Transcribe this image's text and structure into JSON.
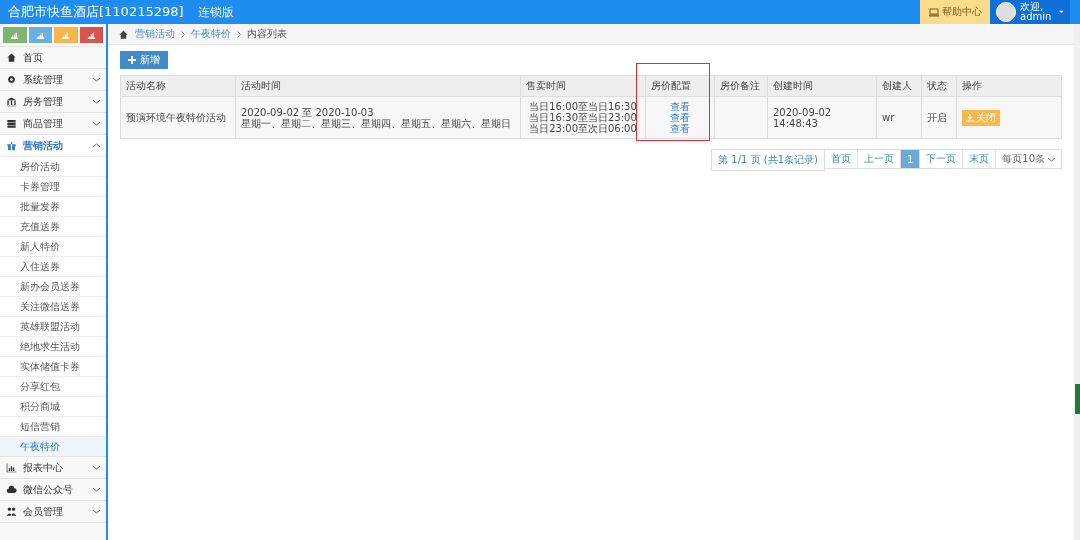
{
  "header": {
    "title": "合肥市快鱼酒店[110215298]",
    "edition": "连锁版",
    "help": "帮助中心",
    "welcome": "欢迎,",
    "user": "admin"
  },
  "quick_buttons": [
    {
      "color": "#7fb572"
    },
    {
      "color": "#6db0e0"
    },
    {
      "color": "#f9b44a"
    },
    {
      "color": "#d9534f"
    }
  ],
  "sidebar": [
    {
      "label": "首页",
      "selected": false
    },
    {
      "label": "系统管理",
      "expanded": false,
      "selected": false
    },
    {
      "label": "房务管理",
      "expanded": false,
      "selected": false
    },
    {
      "label": "商品管理",
      "expanded": false,
      "selected": false
    },
    {
      "label": "营销活动",
      "expanded": true,
      "selected": true,
      "children": [
        {
          "label": "房价活动",
          "selected": false
        },
        {
          "label": "卡券管理",
          "selected": false
        },
        {
          "label": "批量发券",
          "selected": false
        },
        {
          "label": "充值送券",
          "selected": false
        },
        {
          "label": "新人特价",
          "selected": false
        },
        {
          "label": "入住送券",
          "selected": false
        },
        {
          "label": "新办会员送券",
          "selected": false
        },
        {
          "label": "关注微信送券",
          "selected": false
        },
        {
          "label": "英雄联盟活动",
          "selected": false
        },
        {
          "label": "绝地求生活动",
          "selected": false
        },
        {
          "label": "实体储值卡券",
          "selected": false
        },
        {
          "label": "分享红包",
          "selected": false
        },
        {
          "label": "积分商城",
          "selected": false
        },
        {
          "label": "短信营销",
          "selected": false
        },
        {
          "label": "午夜特价",
          "selected": true
        }
      ]
    },
    {
      "label": "报表中心",
      "expanded": false,
      "selected": false
    },
    {
      "label": "微信公众号",
      "expanded": false,
      "selected": false
    },
    {
      "label": "会员管理",
      "expanded": false,
      "selected": false
    }
  ],
  "breadcrumb": [
    "营销活动",
    "午夜特价",
    "内容列表"
  ],
  "add_button": "新增",
  "table": {
    "columns": [
      "活动名称",
      "活动时间",
      "售卖时间",
      "房价配置",
      "房价备注",
      "创建时间",
      "创建人",
      "状态",
      "操作"
    ],
    "rows": [
      {
        "name": "预演环境午夜特价活动",
        "period": [
          "2020-09-02 至 2020-10-03",
          "星期一、星期二、星期三、星期四、星期五、星期六、星期日"
        ],
        "sale_times": [
          "当日16:00至当日16:30",
          "当日16:30至当日23:00",
          "当日23:00至次日06:00"
        ],
        "price_links": [
          "查看",
          "查看",
          "查看"
        ],
        "created": "2020-09-02 14:48:43",
        "creator": "wr",
        "status": "开启",
        "action": "关闭"
      }
    ]
  },
  "pagination": {
    "info": "第 1/1 页 (共1条记录)",
    "first": "首页",
    "prev": "上一页",
    "pages": [
      {
        "label": "1",
        "selected": true
      }
    ],
    "next": "下一页",
    "last": "末页",
    "page_size": "每页10条"
  }
}
